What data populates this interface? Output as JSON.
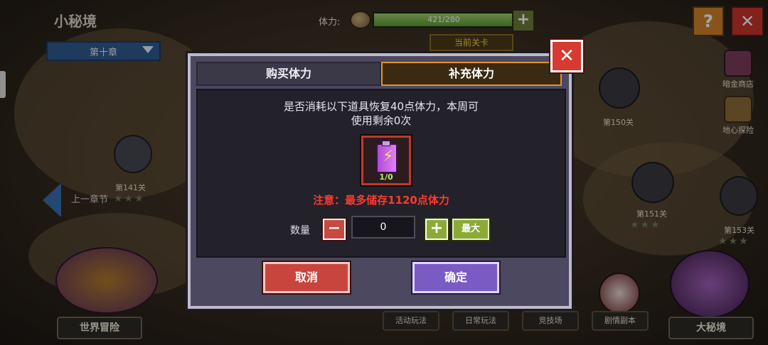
{
  "header": {
    "title": "小秘境",
    "chapter": "第十章",
    "stamina_label": "体力:",
    "stamina_value": "421/280",
    "stamina_fill_fraction": 1.0,
    "current_level": "当前关卡",
    "help": "?",
    "close": "✕"
  },
  "map": {
    "prev_chapter": "上一章节",
    "stages": [
      {
        "label": "第141关"
      },
      {
        "label": "第150关"
      },
      {
        "label": "第151关"
      },
      {
        "label": "第153关"
      }
    ],
    "side_menu": [
      {
        "label": "暗金商店"
      },
      {
        "label": "地心探险"
      }
    ],
    "bottom_tabs": [
      {
        "label": "活动玩法"
      },
      {
        "label": "日常玩法"
      },
      {
        "label": "竞技场"
      },
      {
        "label": "剧情副本"
      }
    ],
    "world_adventure": "世界冒险",
    "big_secret": "大秘境"
  },
  "dialog": {
    "close": "✕",
    "tabs": [
      {
        "label": "购买体力",
        "active": false
      },
      {
        "label": "补充体力",
        "active": true
      }
    ],
    "desc_line1": "是否消耗以下道具恢复40点体力，本周可",
    "desc_line2": "使用剩余0次",
    "item": {
      "icon": "battery-icon",
      "count": "1/0"
    },
    "warning": "注意：最多储存1120点体力",
    "quantity_label": "数量",
    "minus": "−",
    "quantity_value": "0",
    "plus": "+",
    "max": "最大",
    "cancel": "取消",
    "confirm": "确定"
  },
  "colors": {
    "cancel": "#c8453e",
    "confirm": "#7a5bc4",
    "warning": "#ff3a2e",
    "active_tab_border": "#e1932b"
  }
}
